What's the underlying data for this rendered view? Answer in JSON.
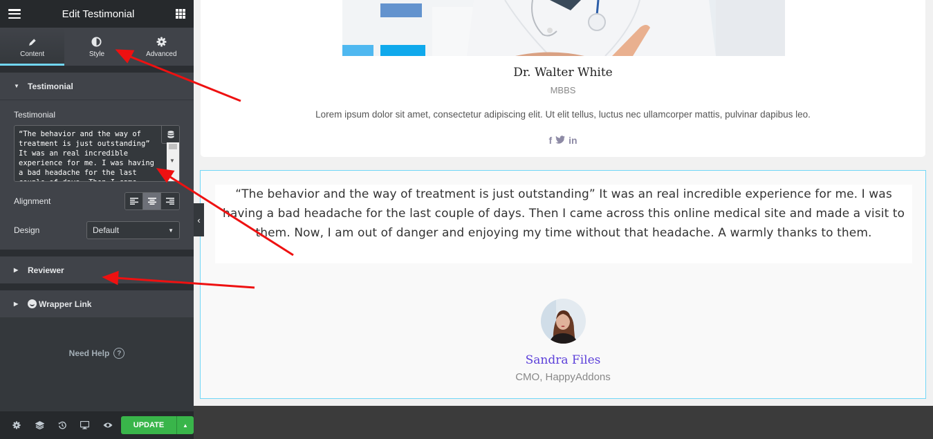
{
  "sidebar": {
    "title": "Edit Testimonial",
    "tabs": [
      {
        "label": "Content",
        "icon": "pencil-icon",
        "active": true
      },
      {
        "label": "Style",
        "icon": "half-circle-icon",
        "active": false
      },
      {
        "label": "Advanced",
        "icon": "gear-icon",
        "active": false
      }
    ],
    "sections": {
      "testimonial": {
        "heading": "Testimonial",
        "field_label": "Testimonial",
        "field_value": "“The behavior and the way of treatment is just outstanding” It was an real incredible experience for me. I was having a bad headache for the last couple of days. Then I came across this online medical site and made a visit to them. Now, I am out of danger and enjoying my time without that headache. A warmly thanks to them.",
        "alignment_label": "Alignment",
        "alignment_options": [
          "left",
          "center",
          "right"
        ],
        "alignment_selected": "center",
        "design_label": "Design",
        "design_value": "Default"
      },
      "reviewer": {
        "heading": "Reviewer"
      },
      "wrapper_link": {
        "heading": "Wrapper Link"
      }
    },
    "help_label": "Need Help",
    "footer": {
      "icons": [
        "settings-icon",
        "layers-icon",
        "history-icon",
        "responsive-icon",
        "preview-eye-icon"
      ],
      "update_label": "UPDATE"
    }
  },
  "preview": {
    "team_member": {
      "name": "Dr. Walter White",
      "title": "MBBS",
      "bio": "Lorem ipsum dolor sit amet, consectetur adipiscing elit. Ut elit tellus, luctus nec ullamcorper mattis, pulvinar dapibus leo.",
      "social": [
        "f",
        "t",
        "in"
      ]
    },
    "testimonial": {
      "quote": "“The behavior and the way of treatment is just outstanding” It was an real incredible experience for me. I was having a bad headache for the last couple of days. Then I came across this online medical site and made a visit to them. Now, I am out of danger and enjoying my time without that headache. A warmly thanks to them.",
      "reviewer_name": "Sandra Files",
      "reviewer_title": "CMO, HappyAddons"
    }
  },
  "colors": {
    "accent_tab": "#71d7f7",
    "update_green": "#39b54a",
    "reviewer_name": "#5b3fd9",
    "annotation_arrow": "#ee1111"
  }
}
